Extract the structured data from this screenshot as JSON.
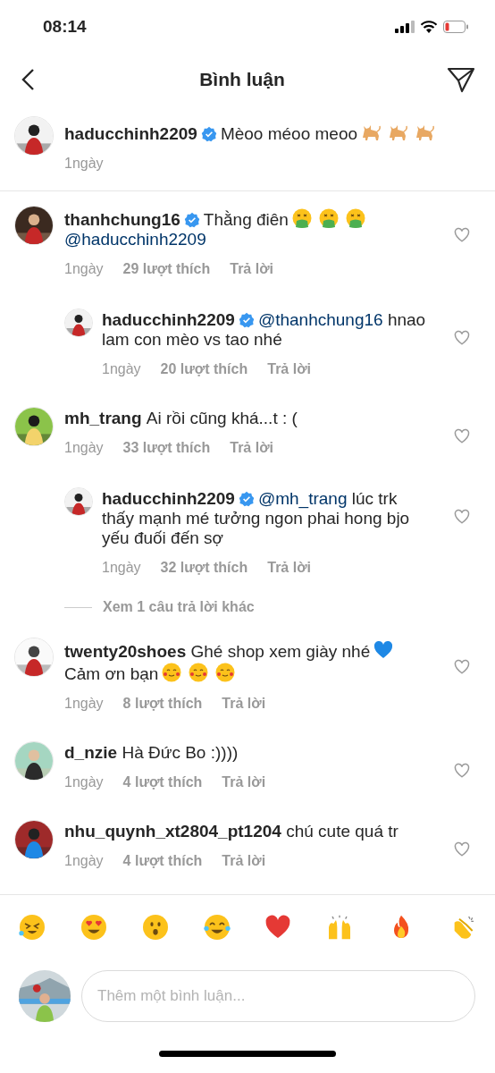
{
  "status_bar": {
    "time": "08:14"
  },
  "header": {
    "title": "Bình luận"
  },
  "caption": {
    "username": "haducchinh2209",
    "verified": true,
    "segments": [
      {
        "kind": "plain",
        "text": "Mèoo méoo meoo"
      }
    ],
    "emojis": [
      {
        "kind": "cat"
      },
      {
        "kind": "cat"
      },
      {
        "kind": "cat"
      }
    ],
    "time": "1ngày"
  },
  "comments": [
    {
      "username": "thanhchung16",
      "verified": true,
      "segments": [
        {
          "kind": "plain",
          "text": "Thằng điên"
        },
        {
          "kind": "vomit"
        },
        {
          "kind": "vomit"
        },
        {
          "kind": "vomit"
        },
        {
          "kind": "mention",
          "text": "@haducchinh2209"
        }
      ],
      "time": "1ngày",
      "likes": "29 lượt thích",
      "reply": "Trả lời",
      "children": [
        {
          "username": "haducchinh2209",
          "verified": true,
          "segments": [
            {
              "kind": "mention",
              "text": "@thanhchung16"
            },
            {
              "kind": "plain",
              "text": "hnao"
            },
            {
              "kind": "plain",
              "text": "lam con mèo vs tao nhé"
            }
          ],
          "time": "1ngày",
          "likes": "20 lượt thích",
          "reply": "Trả lời"
        }
      ]
    },
    {
      "username": "mh_trang",
      "verified": false,
      "segments": [
        {
          "kind": "plain",
          "text": "Ai rồi cũng khá...t : ("
        }
      ],
      "time": "1ngày",
      "likes": "33 lượt thích",
      "reply": "Trả lời",
      "children": [
        {
          "username": "haducchinh2209",
          "verified": true,
          "segments": [
            {
              "kind": "mention",
              "text": "@mh_trang"
            },
            {
              "kind": "plain",
              "text": "lúc trk"
            },
            {
              "kind": "plain",
              "text": "thấy mạnh mé tưởng ngon phai hong bjo"
            },
            {
              "kind": "plain",
              "text": "yếu đuối đến sợ"
            }
          ],
          "time": "1ngày",
          "likes": "32 lượt thích",
          "reply": "Trả lời"
        }
      ],
      "more_replies": "Xem 1 câu trả lời khác"
    },
    {
      "username": "twenty20shoes",
      "verified": false,
      "segments": [
        {
          "kind": "plain",
          "text": "Ghé shop xem giày nhé"
        },
        {
          "kind": "blue-heart"
        },
        {
          "kind": "plain",
          "text": "Cảm ơn bạn"
        },
        {
          "kind": "love-face"
        },
        {
          "kind": "love-face"
        },
        {
          "kind": "love-face"
        }
      ],
      "time": "1ngày",
      "likes": "8 lượt thích",
      "reply": "Trả lời"
    },
    {
      "username": "d_nzie",
      "verified": false,
      "segments": [
        {
          "kind": "plain",
          "text": "Hà Đức Bo :))))"
        }
      ],
      "time": "1ngày",
      "likes": "4 lượt thích",
      "reply": "Trả lời"
    },
    {
      "username": "nhu_quynh_xt2804_pt1204",
      "verified": false,
      "segments": [
        {
          "kind": "plain",
          "text": "chú cute quá tr"
        }
      ],
      "time": "1ngày",
      "likes": "4 lượt thích",
      "reply": "Trả lời"
    }
  ],
  "emoji_bar": [
    {
      "kind": "rofl"
    },
    {
      "kind": "heart-eyes"
    },
    {
      "kind": "surprised"
    },
    {
      "kind": "tears-of-joy"
    },
    {
      "kind": "red-heart"
    },
    {
      "kind": "raised-hands"
    },
    {
      "kind": "fire"
    },
    {
      "kind": "clap"
    }
  ],
  "composer": {
    "placeholder": "Thêm một bình luận..."
  }
}
